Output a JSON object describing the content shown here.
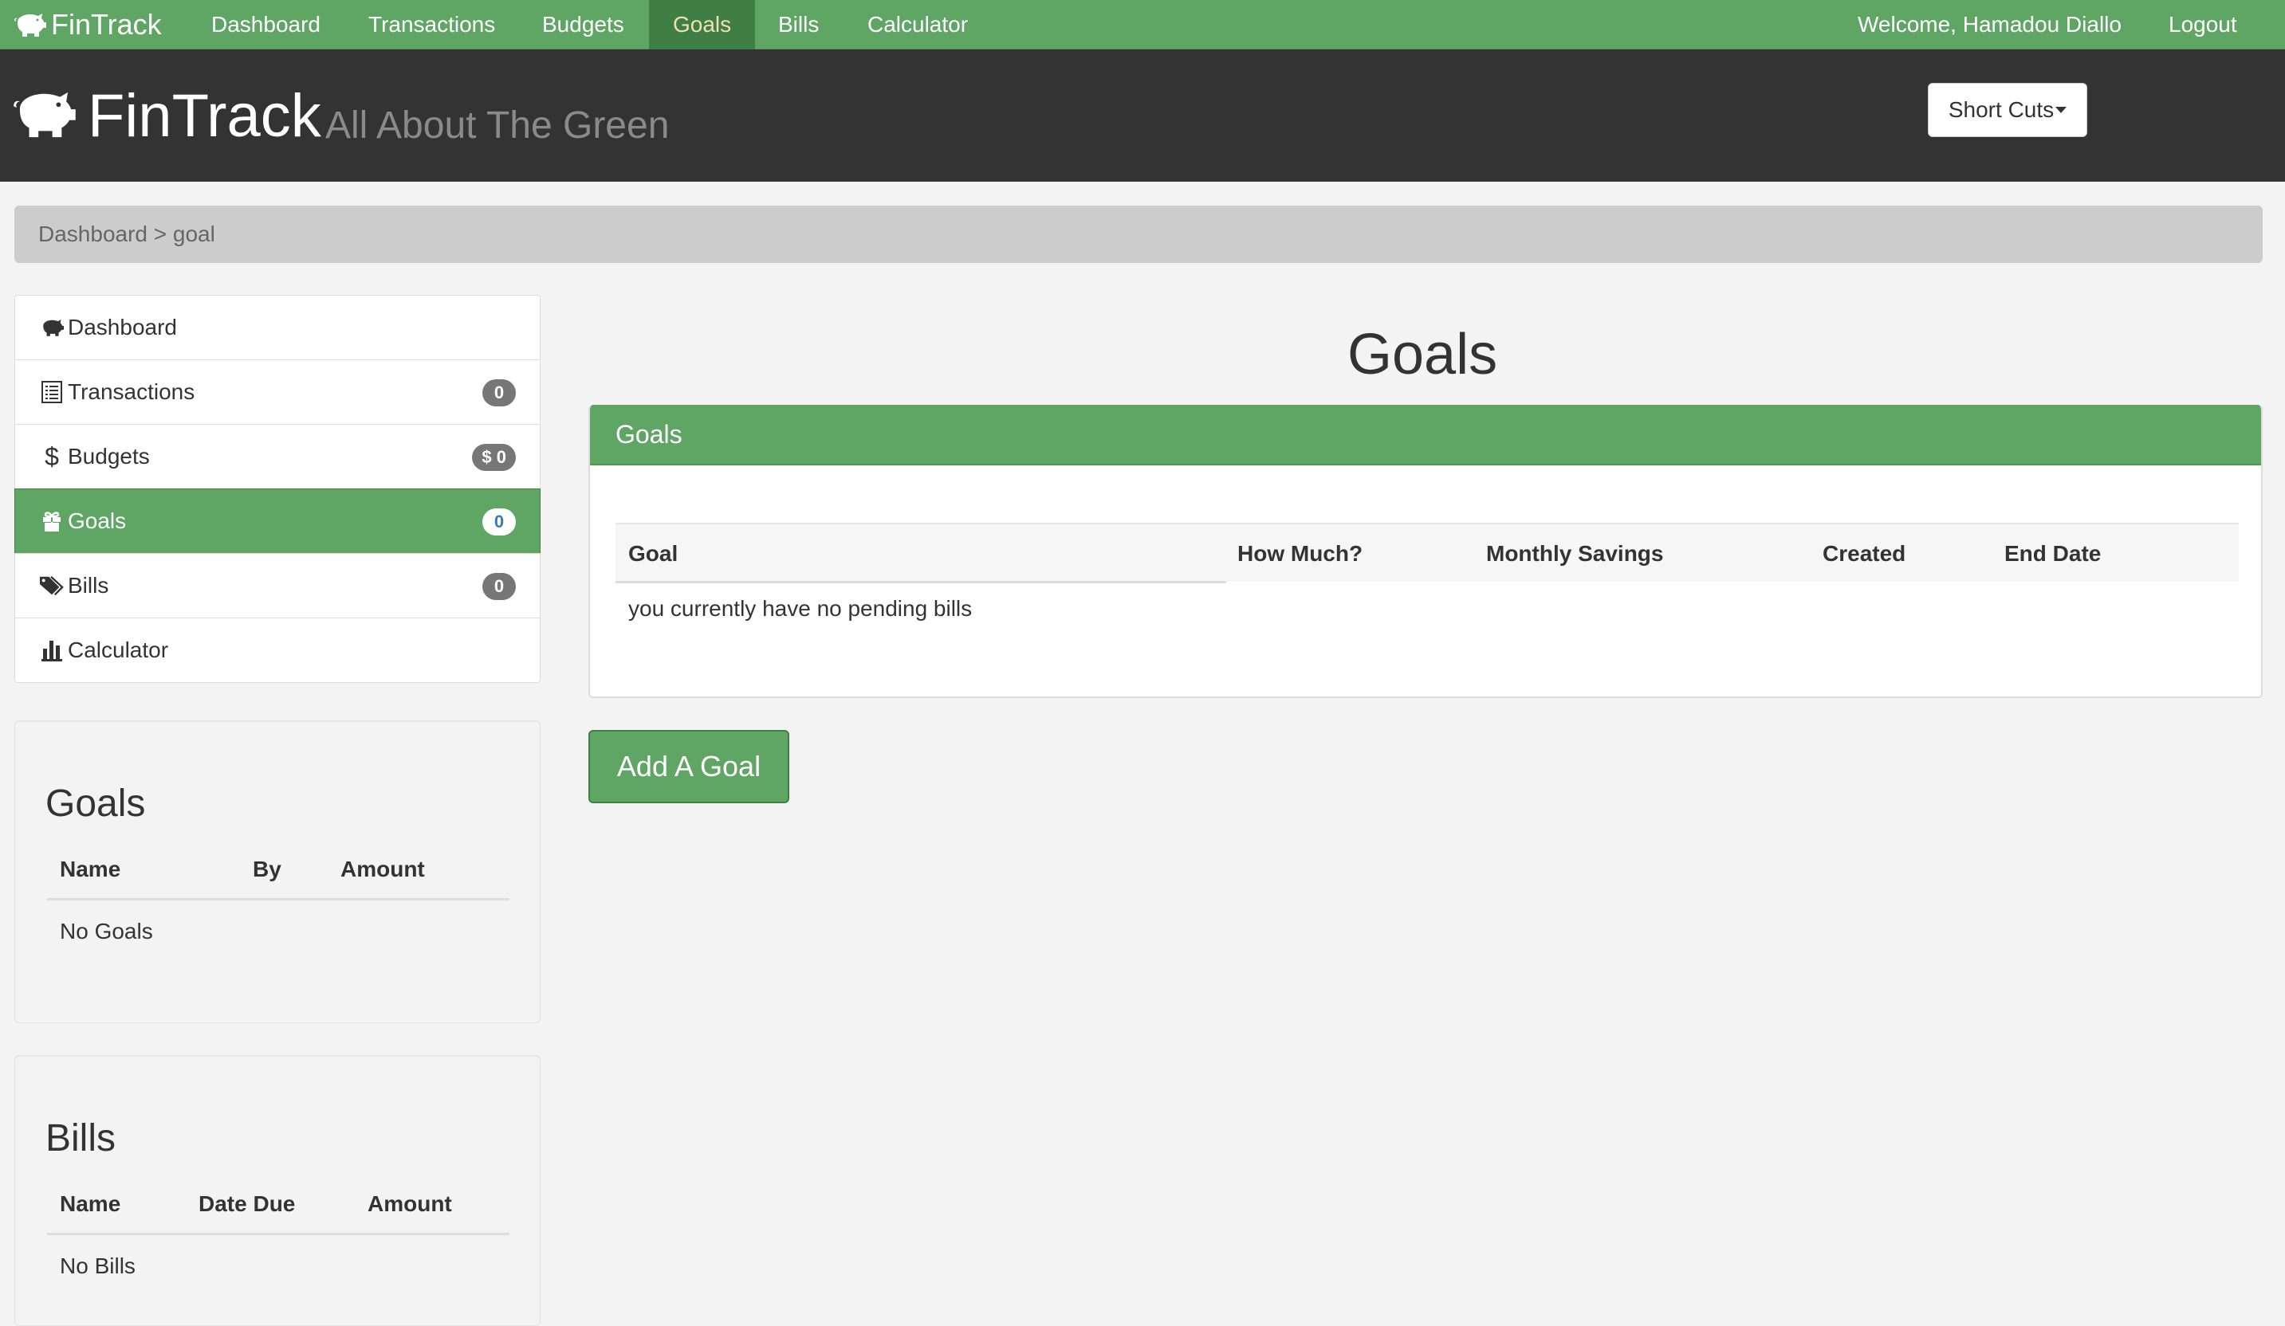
{
  "topnav": {
    "brand": "FinTrack",
    "items": [
      {
        "label": "Dashboard"
      },
      {
        "label": "Transactions"
      },
      {
        "label": "Budgets"
      },
      {
        "label": "Goals",
        "active": true
      },
      {
        "label": "Bills"
      },
      {
        "label": "Calculator"
      }
    ],
    "welcome": "Welcome, Hamadou Diallo",
    "logout": "Logout"
  },
  "banner": {
    "title": "FinTrack",
    "tagline": "All About The Green",
    "shortcuts_label": "Short Cuts"
  },
  "breadcrumb": "Dashboard > goal",
  "sidebar": {
    "items": [
      {
        "label": "Dashboard",
        "icon": "piggy-bank-icon"
      },
      {
        "label": "Transactions",
        "icon": "list-icon",
        "badge": "0"
      },
      {
        "label": "Budgets",
        "icon": "dollar-icon",
        "badge": "$ 0"
      },
      {
        "label": "Goals",
        "icon": "gift-icon",
        "badge": "0",
        "active": true
      },
      {
        "label": "Bills",
        "icon": "tags-icon",
        "badge": "0"
      },
      {
        "label": "Calculator",
        "icon": "bar-chart-icon"
      }
    ]
  },
  "goals_panel": {
    "title": "Goals",
    "headers": [
      "Name",
      "By",
      "Amount"
    ],
    "empty": "No Goals"
  },
  "bills_panel": {
    "title": "Bills",
    "headers": [
      "Name",
      "Date Due",
      "Amount"
    ],
    "empty": "No Bills"
  },
  "main": {
    "title": "Goals",
    "panel_title": "Goals",
    "headers": [
      "Goal",
      "How Much?",
      "Monthly Savings",
      "Created",
      "End Date"
    ],
    "empty": "you currently have no pending bills",
    "add_button": "Add A Goal"
  },
  "colors": {
    "brand_green": "#5fa664",
    "active_nav": "#3f7f44",
    "banner_bg": "#333333"
  }
}
